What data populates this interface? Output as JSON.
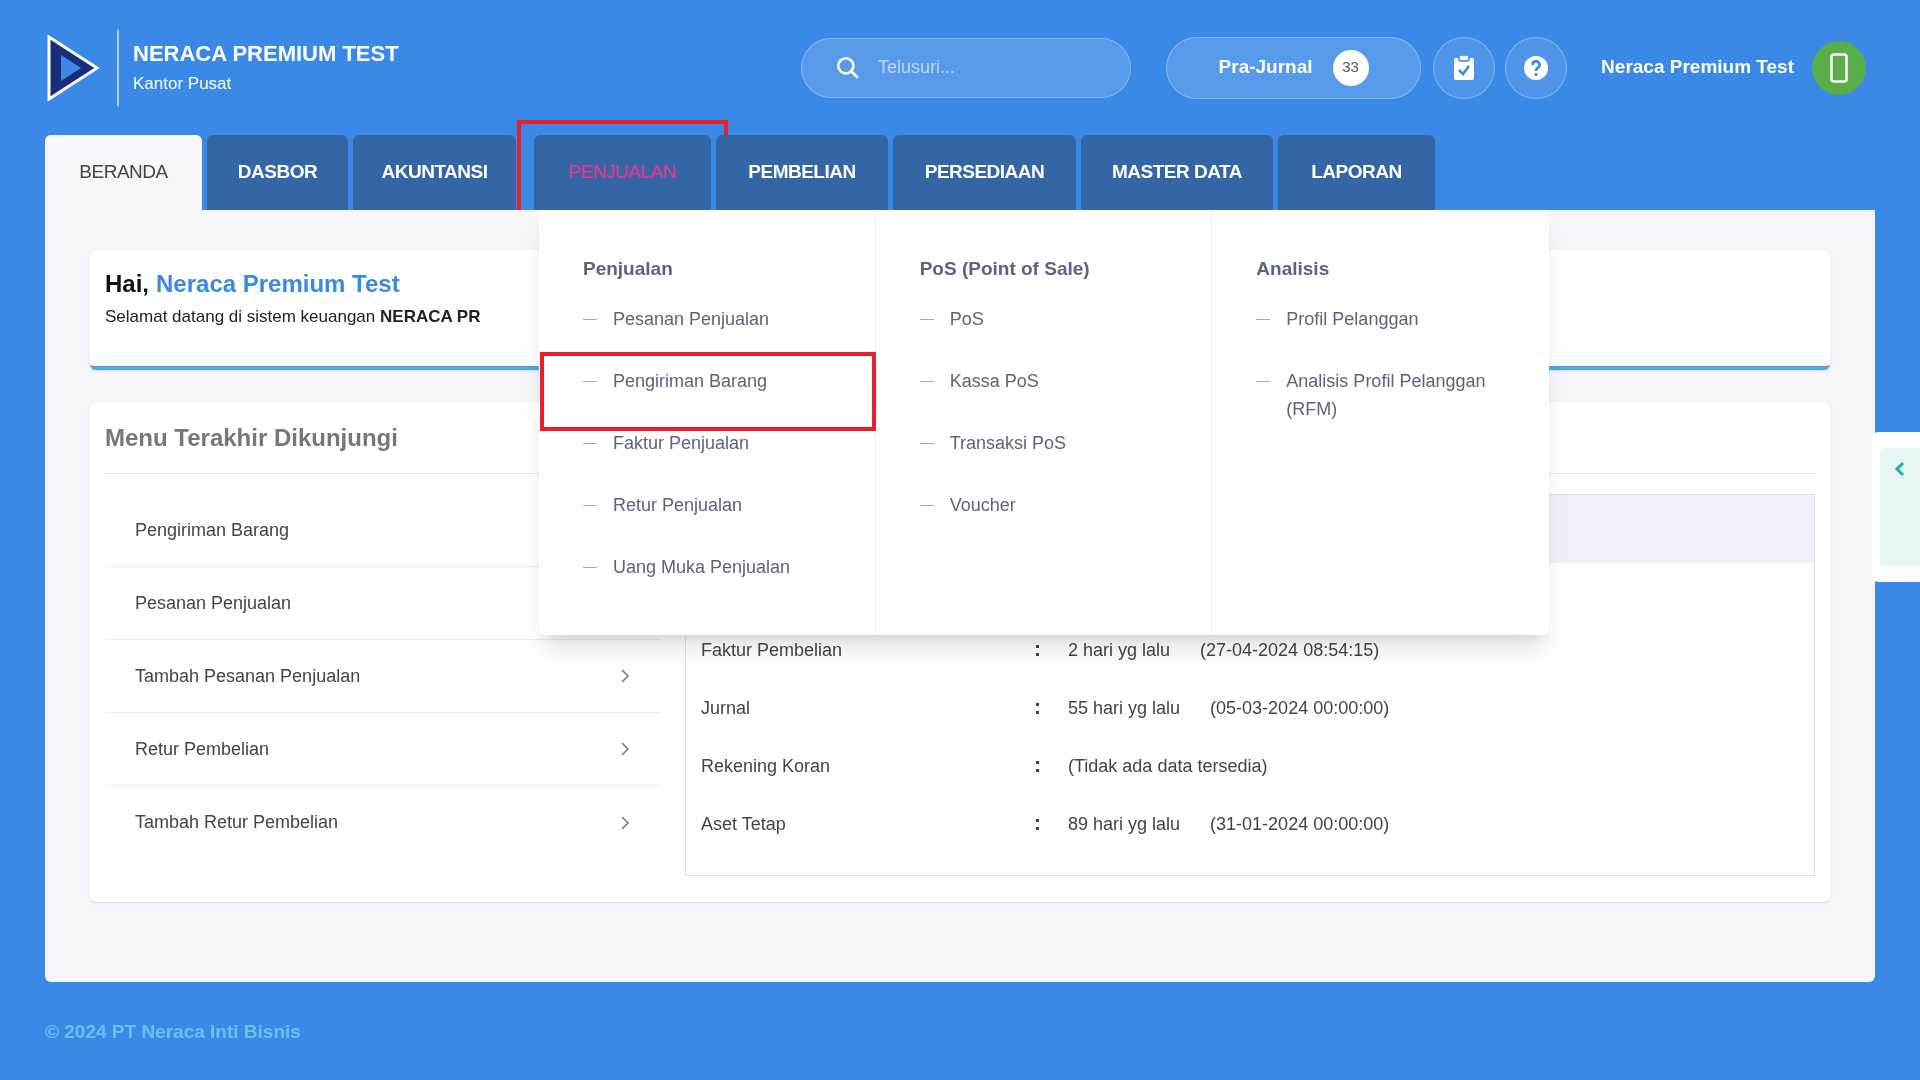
{
  "app": {
    "title": "NERACA PREMIUM TEST",
    "subtitle": "Kantor Pusat"
  },
  "search": {
    "placeholder": "Telusuri..."
  },
  "pra_jurnal": {
    "label": "Pra-Jurnal",
    "count": "33"
  },
  "user": {
    "name": "Neraca Premium Test"
  },
  "tabs": [
    {
      "label": "BERANDA",
      "selected": true,
      "open": false,
      "highlighted": false
    },
    {
      "label": "DASBOR",
      "selected": false,
      "open": false,
      "highlighted": false
    },
    {
      "label": "AKUNTANSI",
      "selected": false,
      "open": false,
      "highlighted": false
    },
    {
      "label": "PENJUALAN",
      "selected": false,
      "open": true,
      "highlighted": true
    },
    {
      "label": "PEMBELIAN",
      "selected": false,
      "open": false,
      "highlighted": false
    },
    {
      "label": "PERSEDIAAN",
      "selected": false,
      "open": false,
      "highlighted": false
    },
    {
      "label": "MASTER DATA",
      "selected": false,
      "open": false,
      "highlighted": false
    },
    {
      "label": "LAPORAN",
      "selected": false,
      "open": false,
      "highlighted": false
    }
  ],
  "greeting": {
    "salutation": "Hai,",
    "name": "Neraca Premium Test",
    "message": "Selamat datang di sistem keuangan **NERACA PR**"
  },
  "recent_menu": {
    "title": "Menu Terakhir Dikunjungi",
    "items": [
      {
        "label": "Pengiriman Barang"
      },
      {
        "label": "Pesanan Penjualan"
      },
      {
        "label": "Tambah Pesanan Penjualan",
        "chevron": true
      },
      {
        "label": "Retur Pembelian",
        "chevron": true
      },
      {
        "label": "Tambah Retur Pembelian",
        "chevron": true
      }
    ]
  },
  "activity": {
    "rows": [
      {
        "label": "Faktur Pembelian",
        "value": "2 hari yg lalu",
        "timestamp": "(27-04-2024 08:54:15)"
      },
      {
        "label": "Jurnal",
        "value": "55 hari yg lalu",
        "timestamp": "(05-03-2024 00:00:00)"
      },
      {
        "label": "Rekening Koran",
        "value": "(Tidak ada data tersedia)"
      },
      {
        "label": "Aset Tetap",
        "value": "89 hari yg lalu",
        "timestamp": "(31-01-2024 00:00:00)"
      }
    ]
  },
  "dropdown": {
    "columns": [
      {
        "heading": "Penjualan",
        "items": [
          {
            "label": "Pesanan Penjualan",
            "highlighted": false
          },
          {
            "label": "Pengiriman Barang",
            "highlighted": true
          },
          {
            "label": "Faktur Penjualan",
            "highlighted": false
          },
          {
            "label": "Retur Penjualan",
            "highlighted": false
          },
          {
            "label": "Uang Muka Penjualan",
            "highlighted": false
          }
        ]
      },
      {
        "heading": "PoS (Point of Sale)",
        "items": [
          {
            "label": "PoS",
            "highlighted": false
          },
          {
            "label": "Kassa PoS",
            "highlighted": false
          },
          {
            "label": "Transaksi PoS",
            "highlighted": false
          },
          {
            "label": "Voucher",
            "highlighted": false
          }
        ]
      },
      {
        "heading": "Analisis",
        "items": [
          {
            "label": "Profil Pelanggan",
            "highlighted": false
          },
          {
            "label": "Analisis Profil Pelanggan (RFM)",
            "highlighted": false
          }
        ]
      }
    ]
  },
  "footer": "© 2024 PT Neraca Inti Bisnis"
}
